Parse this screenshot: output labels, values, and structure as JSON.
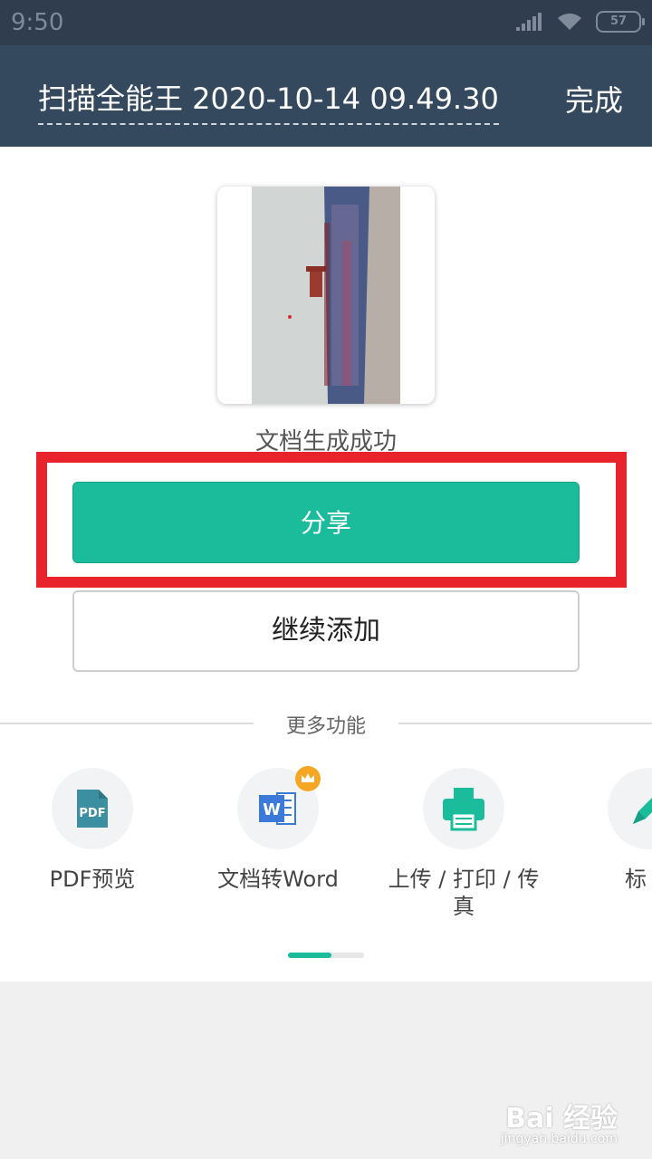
{
  "status_bar": {
    "time": "9:50",
    "battery": "57"
  },
  "header": {
    "title": "扫描全能王 2020-10-14 09.49.30",
    "done_label": "完成"
  },
  "main": {
    "success_text": "文档生成成功",
    "share_label": "分享",
    "continue_label": "继续添加"
  },
  "more": {
    "title": "更多功能",
    "features": [
      {
        "label": "PDF预览",
        "icon": "pdf-icon"
      },
      {
        "label": "文档转Word",
        "icon": "word-icon"
      },
      {
        "label_line1": "上传 / 打印 / 传",
        "label_line2": "真",
        "icon": "printer-icon"
      },
      {
        "label": "标",
        "icon": "pen-icon"
      }
    ]
  },
  "pager": {
    "active_page": 1,
    "page_count": 2
  },
  "watermark": {
    "brand": "Bai 经验",
    "url": "jingyan.baidu.com"
  },
  "colors": {
    "header_bg": "#34495e",
    "accent": "#1abc9c",
    "highlight_frame": "#e8232b"
  }
}
